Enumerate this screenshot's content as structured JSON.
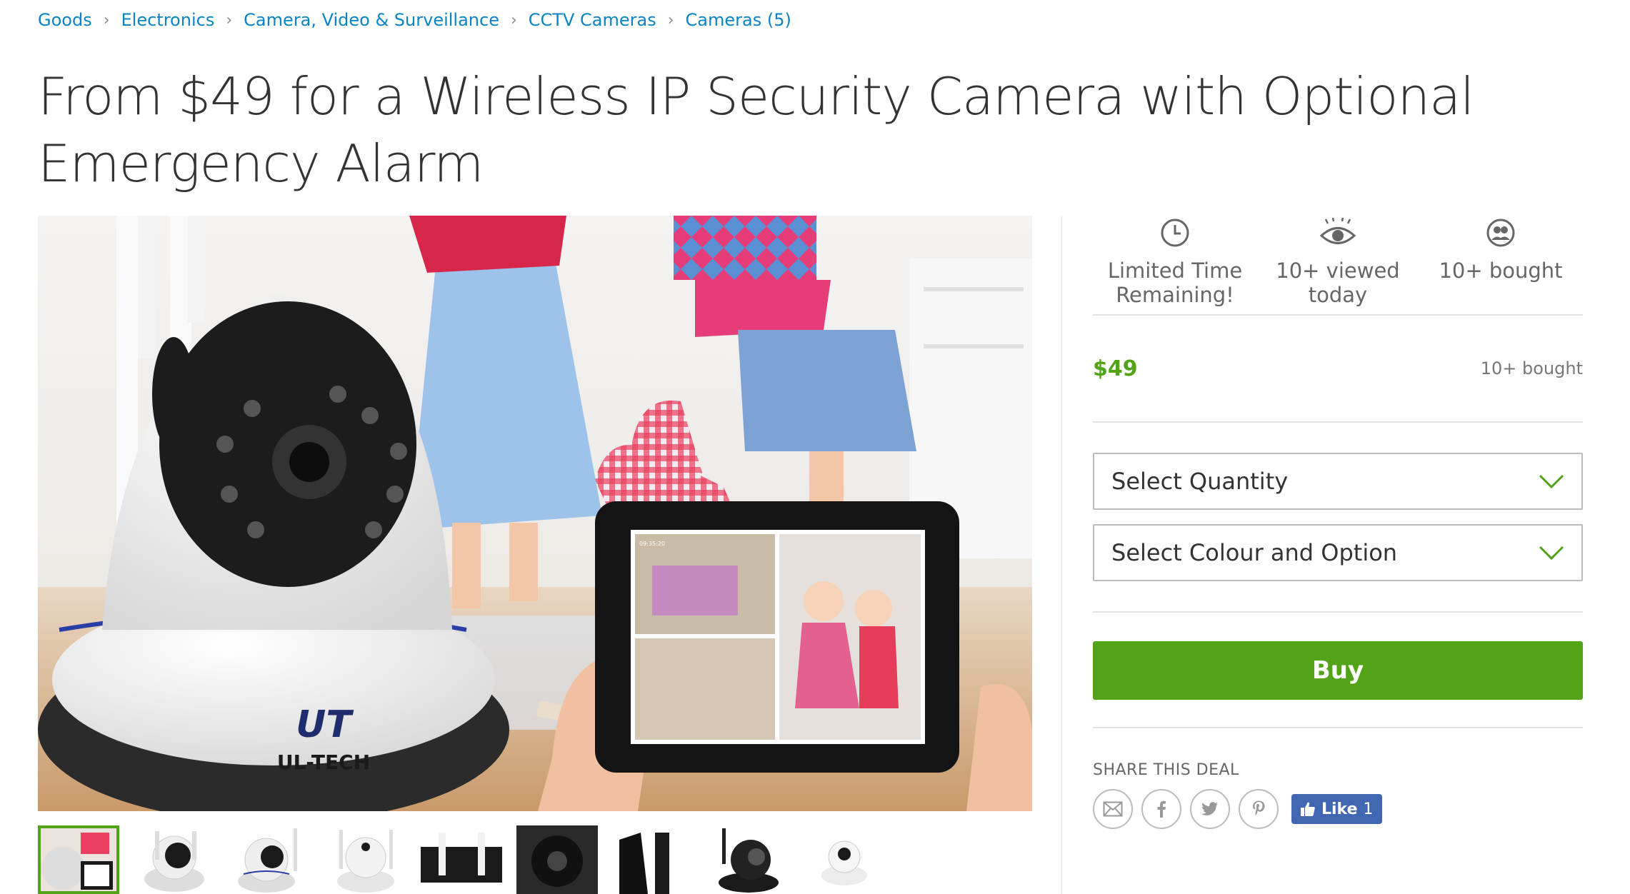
{
  "breadcrumb": [
    {
      "label": "Goods"
    },
    {
      "label": "Electronics"
    },
    {
      "label": "Camera, Video & Surveillance"
    },
    {
      "label": "CCTV Cameras"
    },
    {
      "label": "Cameras (5)"
    }
  ],
  "title": "From $49 for a Wireless IP Security Camera with Optional Emergency Alarm",
  "hero": {
    "brand": "UL-TECH",
    "brand_mark": "UT",
    "tablet_timestamp": "09:35:20"
  },
  "stats": [
    {
      "icon": "clock-icon",
      "label": "Limited Time Remaining!"
    },
    {
      "icon": "eye-icon",
      "label": "10+ viewed today"
    },
    {
      "icon": "users-icon",
      "label": "10+ bought"
    }
  ],
  "offer": {
    "price": "$49",
    "bought": "10+ bought"
  },
  "selects": {
    "quantity": "Select Quantity",
    "option": "Select Colour and Option"
  },
  "buy_label": "Buy",
  "share": {
    "label": "SHARE THIS DEAL",
    "icons": [
      "email-icon",
      "facebook-icon",
      "twitter-icon",
      "pinterest-icon"
    ],
    "like_label": "Like",
    "like_count": "1"
  },
  "colors": {
    "link": "#0a84c6",
    "accent": "#53a318",
    "facebook": "#4267b2"
  },
  "thumbnails": 9
}
